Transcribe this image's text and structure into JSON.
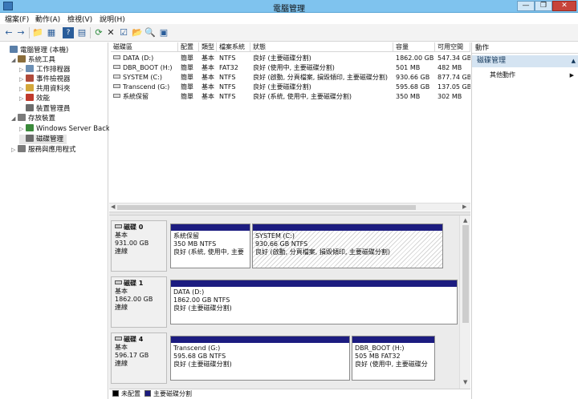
{
  "window": {
    "title": "電腦管理",
    "min": "—",
    "max": "❐",
    "close": "✕"
  },
  "menu": [
    "檔案(F)",
    "動作(A)",
    "檢視(V)",
    "說明(H)"
  ],
  "toolbar": [
    "←",
    "→",
    "📁",
    "▦",
    "?",
    "▤",
    "⟳",
    "✕",
    "☑",
    "📂",
    "🔍",
    "▣"
  ],
  "tree": [
    {
      "label": "電腦管理 (本機)",
      "twisty": "",
      "color": "#5a7fa8",
      "indent": 0
    },
    {
      "label": "系統工具",
      "twisty": "◢",
      "color": "#8a6d3b",
      "indent": 1
    },
    {
      "label": "工作排程器",
      "twisty": "▷",
      "color": "#6b8fb5",
      "indent": 2
    },
    {
      "label": "事件檢視器",
      "twisty": "▷",
      "color": "#b04a3a",
      "indent": 2
    },
    {
      "label": "共用資料夾",
      "twisty": "▷",
      "color": "#d4a73a",
      "indent": 2
    },
    {
      "label": "效能",
      "twisty": "▷",
      "color": "#c0392b",
      "indent": 2
    },
    {
      "label": "裝置管理員",
      "twisty": "",
      "color": "#6c6c6c",
      "indent": 2
    },
    {
      "label": "存放裝置",
      "twisty": "◢",
      "color": "#7a7a7a",
      "indent": 1
    },
    {
      "label": "Windows Server Backu",
      "twisty": "▷",
      "color": "#3a8a3a",
      "indent": 2
    },
    {
      "label": "磁碟管理",
      "twisty": "",
      "color": "#6c6c6c",
      "indent": 2
    },
    {
      "label": "服務與應用程式",
      "twisty": "▷",
      "color": "#7a7a7a",
      "indent": 1
    }
  ],
  "volume_table": {
    "headers": [
      "磁碟區",
      "配置",
      "類型",
      "檔案系統",
      "狀態",
      "容量",
      "可用空間"
    ],
    "rows": [
      [
        "DATA (D:)",
        "簡單",
        "基本",
        "NTFS",
        "良好 (主要磁碟分割)",
        "1862.00 GB",
        "547.34 GB"
      ],
      [
        "DBR_BOOT (H:)",
        "簡單",
        "基本",
        "FAT32",
        "良好 (使用中, 主要磁碟分割)",
        "501 MB",
        "482 MB"
      ],
      [
        "SYSTEM (C:)",
        "簡單",
        "基本",
        "NTFS",
        "良好 (啟動, 分頁檔案, 損毀傾印, 主要磁碟分割)",
        "930.66 GB",
        "877.74 GB"
      ],
      [
        "Transcend (G:)",
        "簡單",
        "基本",
        "NTFS",
        "良好 (主要磁碟分割)",
        "595.68 GB",
        "137.05 GB"
      ],
      [
        "系統保留",
        "簡單",
        "基本",
        "NTFS",
        "良好 (系統, 使用中, 主要磁碟分割)",
        "350 MB",
        "302 MB"
      ]
    ]
  },
  "disks": [
    {
      "name": "磁碟 0",
      "type": "基本",
      "size": "931.00 GB",
      "status": "連線",
      "partitions": [
        {
          "title": "系統保留",
          "size": "350 MB NTFS",
          "status": "良好 (系統, 使用中, 主要",
          "hatch": false
        },
        {
          "title": "SYSTEM  (C:)",
          "size": "930.66 GB NTFS",
          "status": "良好 (啟動, 分頁檔案, 損毀傾印, 主要磁碟分割)",
          "hatch": true
        }
      ]
    },
    {
      "name": "磁碟 1",
      "type": "基本",
      "size": "1862.00 GB",
      "status": "連線",
      "partitions": [
        {
          "title": "DATA  (D:)",
          "size": "1862.00 GB NTFS",
          "status": "良好 (主要磁碟分割)",
          "hatch": false
        }
      ]
    },
    {
      "name": "磁碟 4",
      "type": "基本",
      "size": "596.17 GB",
      "status": "連線",
      "partitions": [
        {
          "title": "Transcend  (G:)",
          "size": "595.68 GB NTFS",
          "status": "良好 (主要磁碟分割)",
          "hatch": false
        },
        {
          "title": "DBR_BOOT  (H:)",
          "size": "505 MB FAT32",
          "status": "良好 (使用中, 主要磁碟分",
          "hatch": false
        }
      ]
    }
  ],
  "legend": {
    "unallocated": "未配置",
    "primary": "主要磁碟分割",
    "colors": {
      "unallocated": "#000000",
      "primary": "#1c1c80"
    }
  },
  "actions": {
    "header": "動作",
    "section": "磁碟管理",
    "more": "其他動作"
  }
}
